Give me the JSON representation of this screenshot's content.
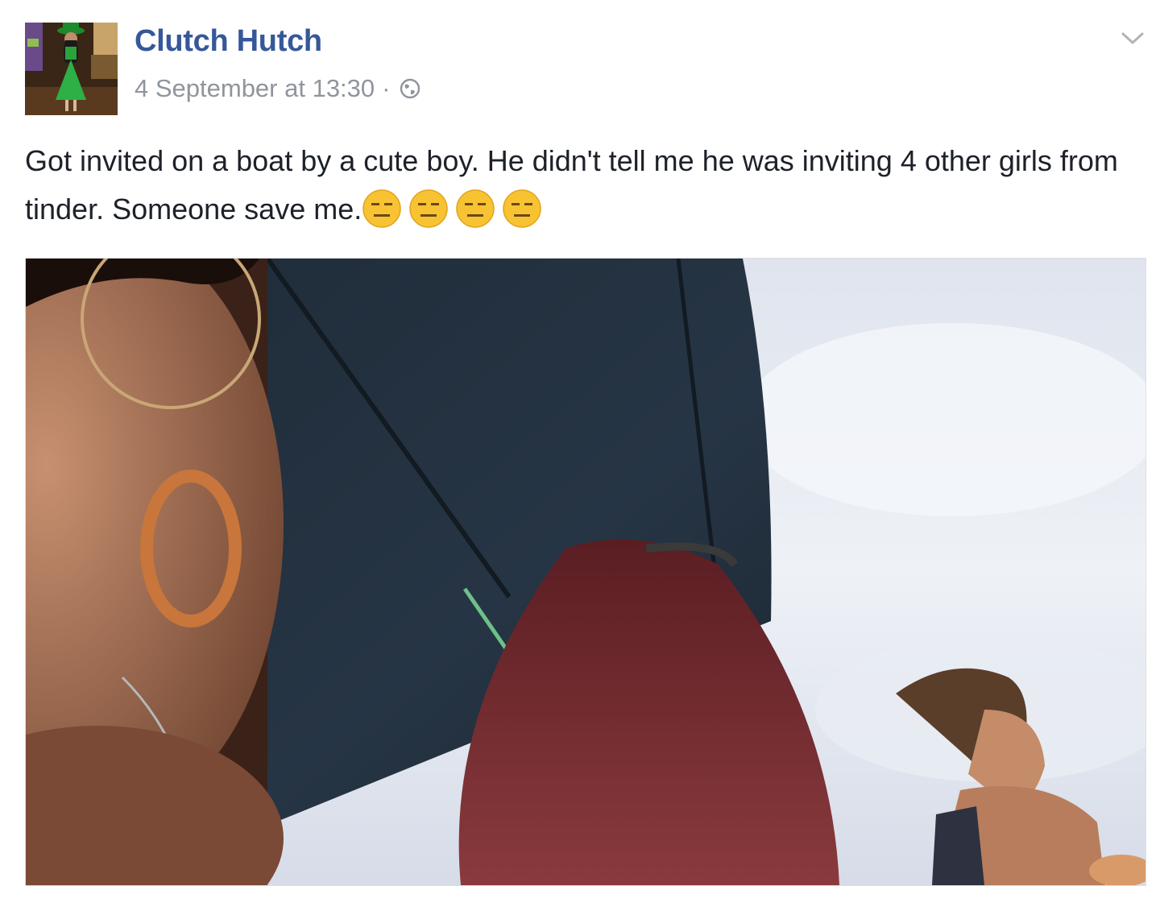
{
  "post": {
    "author": "Clutch Hutch",
    "timestamp": "4 September at 13:30",
    "separator": "·",
    "privacy_icon": "globe-icon",
    "menu_icon": "chevron-down-icon",
    "text": "Got invited on a boat by a cute boy. He didn't tell me he was inviting 4 other girls from tinder. Someone save me.",
    "emoji": [
      "expressionless-face-emoji",
      "expressionless-face-emoji",
      "expressionless-face-emoji",
      "expressionless-face-emoji"
    ]
  },
  "colors": {
    "author_link": "#365899",
    "meta_text": "#90949c",
    "body_text": "#1d2129",
    "emoji_face": "#f7c333"
  }
}
